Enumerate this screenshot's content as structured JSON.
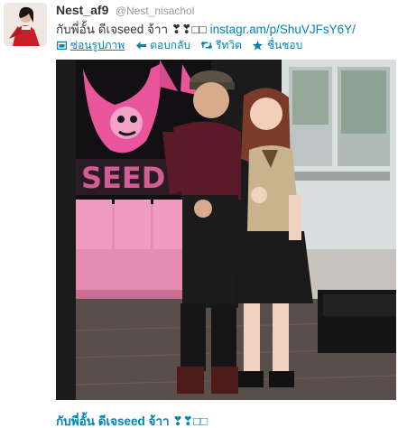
{
  "tweet": {
    "display_name": "Nest_af9",
    "screen_name": "@Nest_nisachol",
    "text_prefix": "กับพี่อั้น ดีเจseed จ้าา ❣❣□□",
    "link_text": "instagr.am/p/ShuVJFsY6Y/",
    "caption": "กับพี่อั้น ดีเจseed จ้าา ❣❣□□"
  },
  "actions": [
    {
      "icon": "photo-icon",
      "label": "ซ่อนรูปภาพ"
    },
    {
      "icon": "reply-icon",
      "label": "ตอบกลับ"
    },
    {
      "icon": "retweet-icon",
      "label": "รีทวิต"
    },
    {
      "icon": "star-icon",
      "label": "ชื่นชอบ"
    }
  ],
  "colors": {
    "link": "#0084b4",
    "text": "#333333",
    "muted": "#999999"
  }
}
